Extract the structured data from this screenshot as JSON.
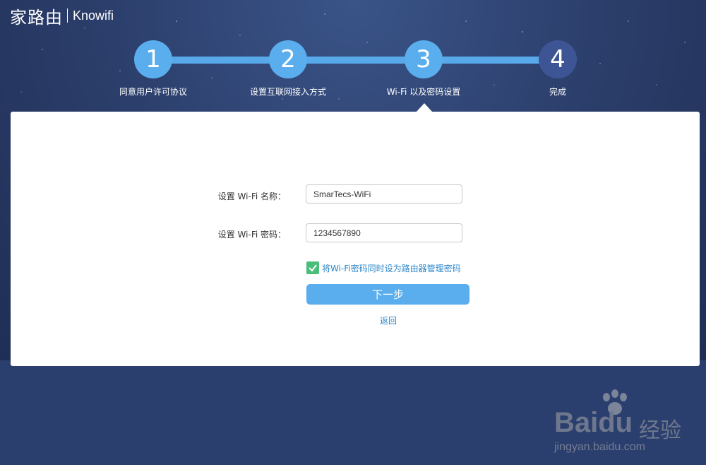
{
  "brand": {
    "name_cn": "家路由",
    "name_en": "Knowifi"
  },
  "steps": [
    {
      "number": "1",
      "label": "同意用户许可协议",
      "status": "done"
    },
    {
      "number": "2",
      "label": "设置互联网接入方式",
      "status": "done"
    },
    {
      "number": "3",
      "label": "Wi-Fi 以及密码设置",
      "status": "current"
    },
    {
      "number": "4",
      "label": "完成",
      "status": "todo"
    }
  ],
  "form": {
    "wifi_name_label": "设置 Wi-Fi 名称：",
    "wifi_name_value": "SmarTecs-WiFi",
    "wifi_password_label": "设置 Wi-Fi 密码：",
    "wifi_password_value": "1234567890",
    "same_password_checked": true,
    "same_password_label": "将Wi-Fi密码同时设为路由器管理密码",
    "next_label": "下一步",
    "back_label": "返回"
  },
  "watermark": {
    "main": "Baidu",
    "cn": "经验",
    "sub": "jingyan.baidu.com"
  },
  "colors": {
    "accent": "#5aaeee",
    "step_todo": "#3d5594",
    "link": "#2a86c9",
    "checkbox": "#4bbd7a",
    "background": "#2b3f6e"
  }
}
